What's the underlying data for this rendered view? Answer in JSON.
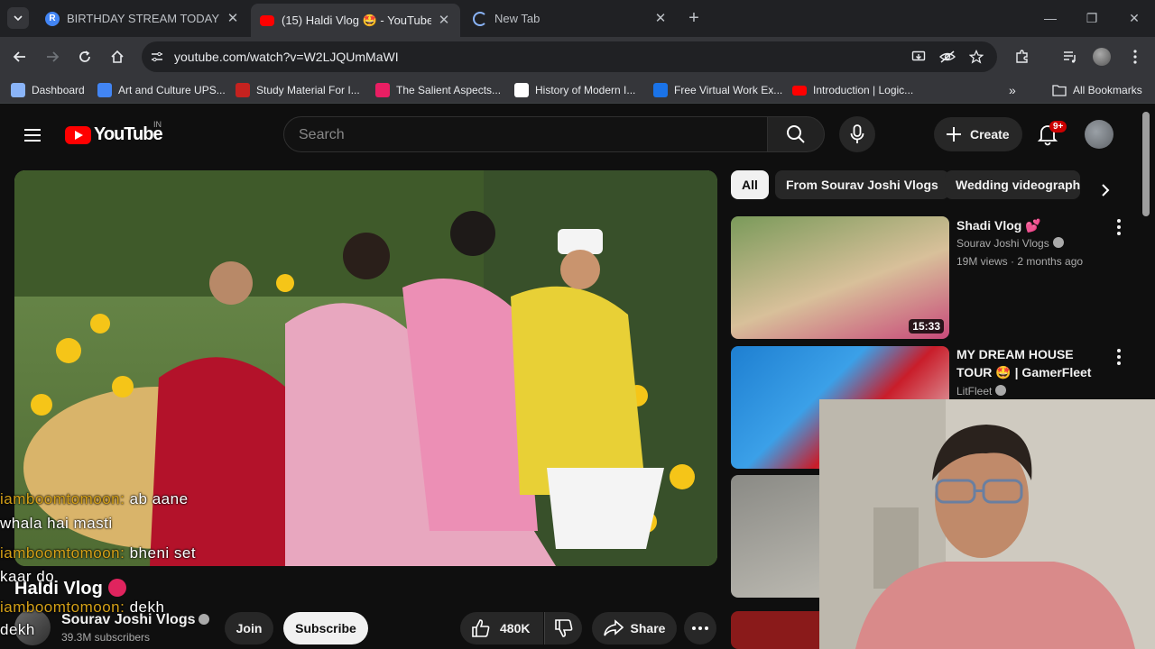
{
  "browser": {
    "tabs": [
      {
        "title": "BIRTHDAY STREAM TODAY| CU",
        "favicon": "R",
        "favicon_color": "#4285f4"
      },
      {
        "title": "(15) Haldi Vlog 🤩 - YouTube",
        "favicon": "",
        "favicon_color": "#ff0000"
      },
      {
        "title": "New Tab",
        "favicon": "",
        "favicon_color": "#8ab4f8"
      }
    ],
    "url": "youtube.com/watch?v=W2LJQUmMaWI",
    "bookmarks": [
      {
        "label": "Dashboard",
        "color": "#8ab4f8"
      },
      {
        "label": "Art and Culture UPS...",
        "color": "#4285f4"
      },
      {
        "label": "Study Material For I...",
        "color": "#c5221f"
      },
      {
        "label": "The Salient Aspects...",
        "color": "#e91e63"
      },
      {
        "label": "History of Modern I...",
        "color": "#ffffff"
      },
      {
        "label": "Free Virtual Work Ex...",
        "color": "#1a73e8"
      },
      {
        "label": "Introduction | Logic...",
        "color": "#ff0000"
      }
    ],
    "all_bookmarks": "All Bookmarks"
  },
  "youtube": {
    "logo_text": "YouTube",
    "country": "IN",
    "search_placeholder": "Search",
    "create_label": "Create",
    "notifications_badge": "9+"
  },
  "video": {
    "title": "Haldi Vlog",
    "channel": "Sourav Joshi Vlogs",
    "subscribers": "39.3M subscribers",
    "join_label": "Join",
    "subscribe_label": "Subscribe",
    "likes": "480K",
    "share_label": "Share"
  },
  "chat": [
    {
      "user": "iamboomtomoon:",
      "message": "ab aane",
      "cont": "whala hai masti"
    },
    {
      "user": "iamboomtomoon:",
      "message": "bheni set",
      "cont": "kaar do"
    },
    {
      "user": "iamboomtomoon:",
      "message": "dekh",
      "cont": "dekh"
    }
  ],
  "chips": [
    "All",
    "From Sourav Joshi Vlogs",
    "Wedding videography"
  ],
  "recommendations": [
    {
      "title": "Shadi Vlog 💕",
      "channel": "Sourav Joshi Vlogs",
      "meta": "19M views · 2 months ago",
      "duration": "15:33"
    },
    {
      "title": "MY DREAM HOUSE TOUR 🤩 | GamerFleet",
      "channel": "LitFleet",
      "meta": "",
      "duration": ""
    }
  ]
}
